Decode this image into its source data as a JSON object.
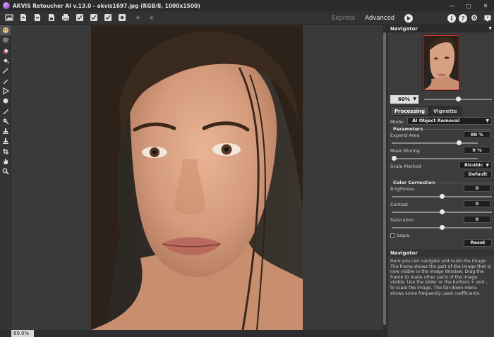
{
  "window": {
    "title": "AKVIS Retoucher AI v.13.0 - akvis1697.jpg (RGB/8, 1000x1500)",
    "minimize": "—",
    "maximize": "□",
    "close": "✕"
  },
  "toolbar": {
    "icons": [
      "open-icon",
      "save-icon",
      "export-icon",
      "print-icon",
      "preset-check-icon",
      "preset-check2-icon",
      "preset-check3-icon",
      "preset-settings-icon",
      "undo-icon",
      "redo-icon"
    ],
    "modes": {
      "express": "Express",
      "advanced": "Advanced"
    },
    "info": "i",
    "help": "?",
    "settings": "⚙"
  },
  "tools": [
    "face-tool-icon",
    "shield-icon",
    "eraser-icon",
    "fill-icon",
    "magic-wand-icon",
    "pencil-icon",
    "lasso-icon",
    "blob-icon",
    "brush-icon",
    "chisel-icon",
    "stamp-icon",
    "stamp2-icon",
    "crop-icon",
    "hand-icon",
    "zoom-icon"
  ],
  "status": {
    "zoom": "60.0%"
  },
  "navigator": {
    "title": "Navigator",
    "zoom_value": "60%",
    "zoom_slider": 0.5
  },
  "tabs": {
    "processing": "Processing",
    "vignette": "Vignette"
  },
  "processing": {
    "mode_label": "Mode:",
    "mode_value": "AI Object Removal",
    "parameters_title": "Parameters",
    "expand_area": {
      "label": "Expand Area",
      "value": "80 %",
      "slider": 0.8
    },
    "mask_bluring": {
      "label": "Mask Bluring",
      "value": "0 %",
      "slider": 0.0
    },
    "scale_method": {
      "label": "Scale Method",
      "value": "Bicubic"
    },
    "default_button": "Default",
    "color_title": "Color Correction",
    "brightness": {
      "label": "Brightness",
      "value": "0",
      "slider": 0.5
    },
    "contrast": {
      "label": "Contast",
      "value": "0",
      "slider": 0.5
    },
    "saturation": {
      "label": "Saturation",
      "value": "0",
      "slider": 0.5
    },
    "sepia_label": "Sepia",
    "reset_button": "Reset"
  },
  "help": {
    "title": "Navigator",
    "text": "Here you can navigate and scale the image. The frame shows the part of the image that is now visible in the Image Window. Drag the frame to make other parts of the image visible. Use the slider or the buttons + and -, to scale the image. The fall-down menu shows some frequently used coefficients."
  }
}
